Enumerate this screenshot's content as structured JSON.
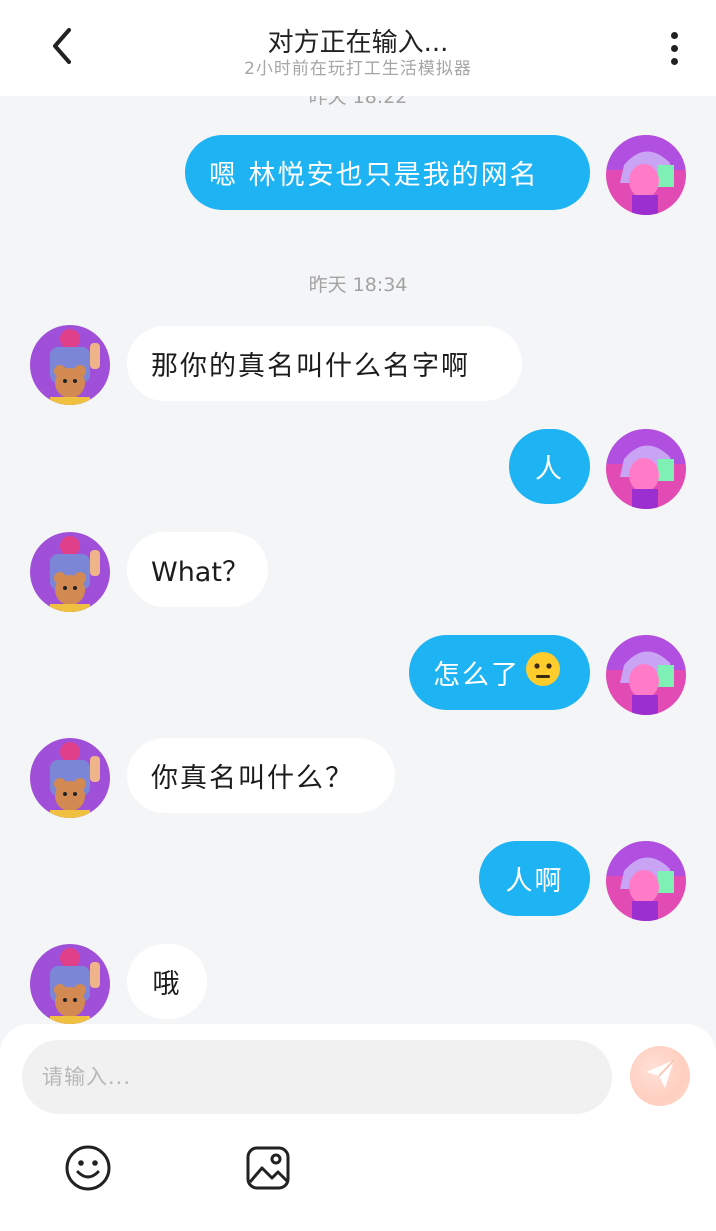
{
  "header": {
    "title": "对方正在输入...",
    "subtitle": "2小时前在玩打工生活模拟器"
  },
  "messages": {
    "ts_top": "昨天 18:22",
    "m1": "嗯 林悦安也只是我的网名",
    "ts_mid": "昨天 18:34",
    "m2": "那你的真名叫什么名字啊",
    "m3": "人",
    "m4": "What？",
    "m5": "怎么了",
    "m6": "你真名叫什么？",
    "m7": "人啊",
    "m8": "哦"
  },
  "composer": {
    "placeholder": "请输入..."
  },
  "icons": {
    "back": "chevron-left-icon",
    "more": "more-vertical-icon",
    "send": "send-icon",
    "emoji": "smiley-icon",
    "image": "image-icon",
    "neutral_face": "neutral-face-emoji"
  },
  "colors": {
    "outgoing_bubble": "#1eb3f3",
    "incoming_bubble": "#ffffff",
    "background": "#f4f5f7"
  }
}
